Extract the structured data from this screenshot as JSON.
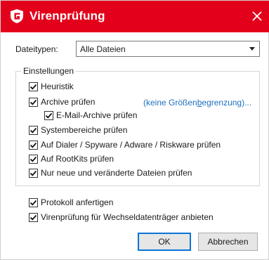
{
  "window": {
    "title": "Virenprüfung",
    "accent": "#e3001b"
  },
  "filetypes": {
    "label": "Dateitypen:",
    "selected": "Alle Dateien"
  },
  "settings": {
    "legend": "Einstellungen",
    "items": [
      {
        "label": "Heuristik",
        "checked": true
      },
      {
        "label": "Archive prüfen",
        "checked": true
      },
      {
        "label": "E-Mail-Archive prüfen",
        "checked": true
      },
      {
        "label": "Systembereiche prüfen",
        "checked": true
      },
      {
        "label": "Auf Dialer / Spyware / Adware / Riskware prüfen",
        "checked": true
      },
      {
        "label": "Auf RootKits prüfen",
        "checked": true
      },
      {
        "label": "Nur neue und veränderte Dateien prüfen",
        "checked": true
      }
    ],
    "link": {
      "before": "(keine Größen",
      "underlined": "b",
      "after": "egrenzung)..."
    }
  },
  "options": [
    {
      "label": "Protokoll anfertigen",
      "checked": true
    },
    {
      "label": "Virenprüfung für Wechseldatenträger anbieten",
      "checked": true
    }
  ],
  "buttons": {
    "ok": "OK",
    "cancel": "Abbrechen"
  },
  "icons": {
    "logo": "gdata-shield-icon",
    "close": "close-icon",
    "check": "checkmark-icon",
    "dropdown": "chevron-down-icon"
  }
}
